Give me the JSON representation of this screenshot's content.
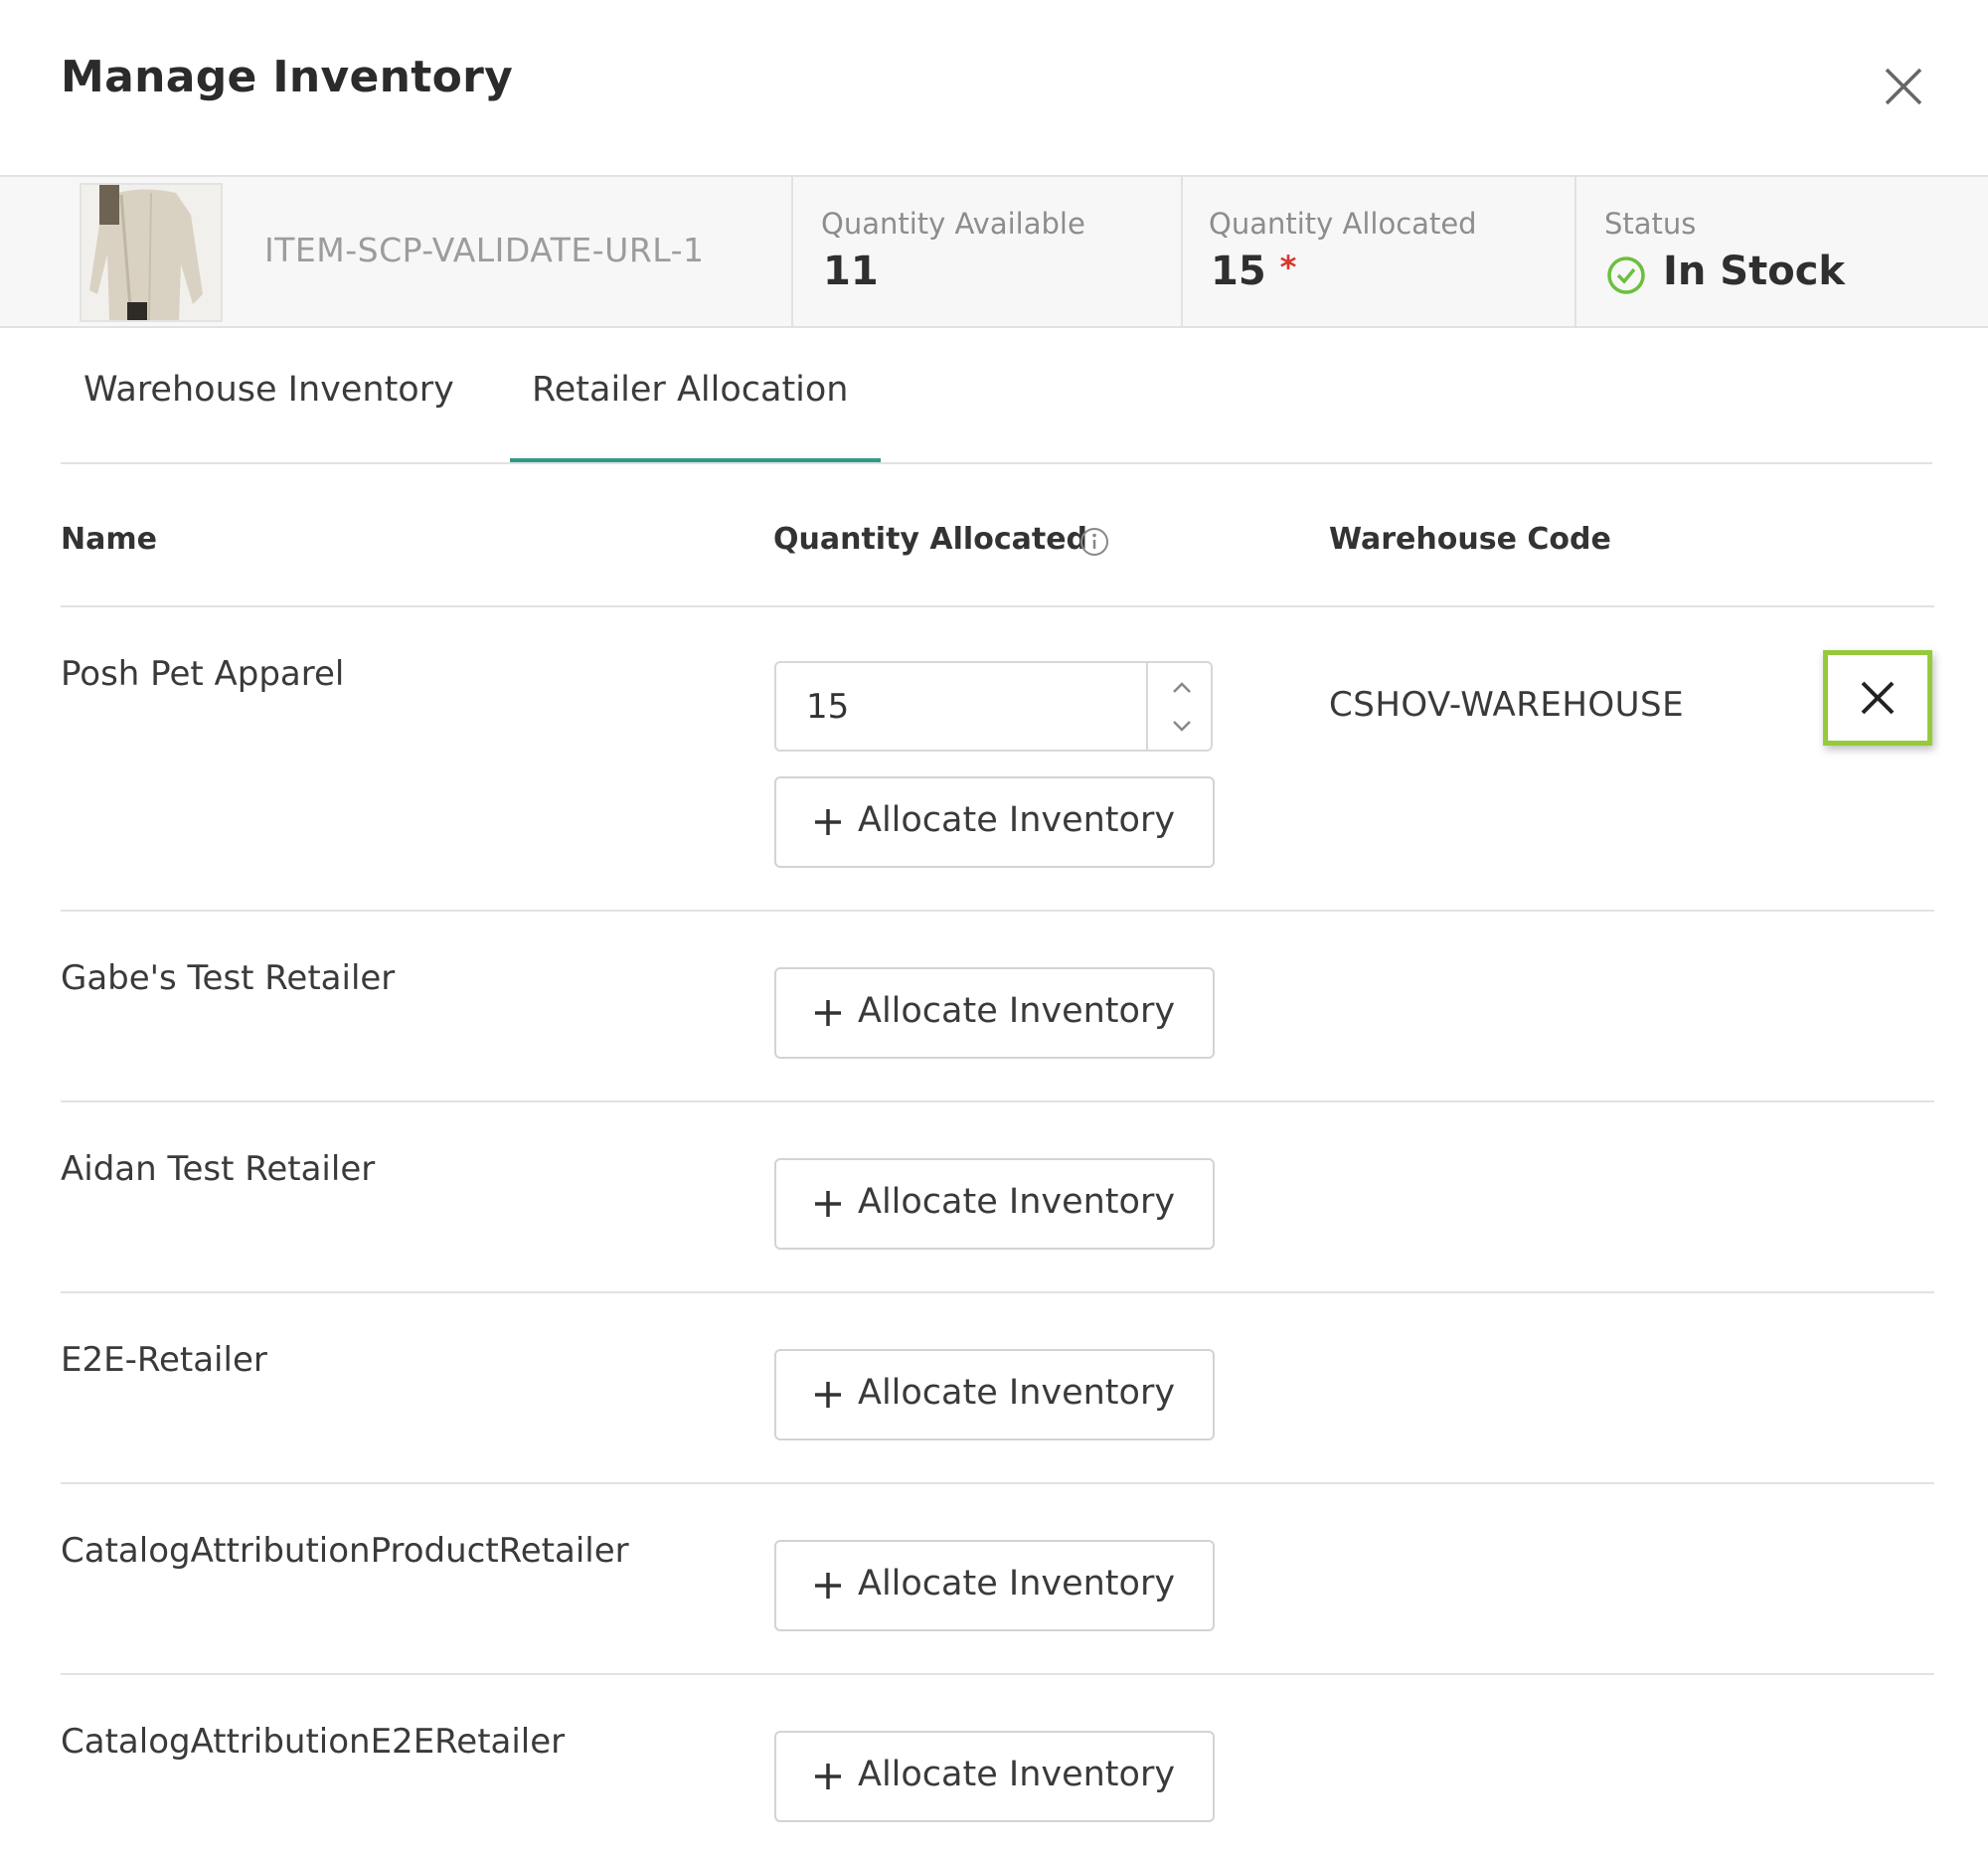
{
  "dialog": {
    "title": "Manage Inventory"
  },
  "item": {
    "sku": "ITEM-SCP-VALIDATE-URL-1",
    "quantity_available_label": "Quantity Available",
    "quantity_available": "11",
    "quantity_allocated_label": "Quantity Allocated",
    "quantity_allocated": "15",
    "required_marker": "*",
    "status_label": "Status",
    "status": "In Stock"
  },
  "tabs": [
    {
      "label": "Warehouse Inventory",
      "active": false
    },
    {
      "label": "Retailer Allocation",
      "active": true
    }
  ],
  "table": {
    "headers": {
      "name": "Name",
      "quantity_allocated": "Quantity Allocated",
      "warehouse_code": "Warehouse Code"
    },
    "rows": [
      {
        "name": "Posh Pet Apparel",
        "quantity": "15",
        "warehouse_code": "CSHOV-WAREHOUSE",
        "button": "Allocate Inventory"
      },
      {
        "name": "Gabe's Test Retailer",
        "button": "Allocate Inventory"
      },
      {
        "name": "Aidan Test Retailer",
        "button": "Allocate Inventory"
      },
      {
        "name": "E2E-Retailer",
        "button": "Allocate Inventory"
      },
      {
        "name": "CatalogAttributionProductRetailer",
        "button": "Allocate Inventory"
      },
      {
        "name": "CatalogAttributionE2ERetailer",
        "button": "Allocate Inventory"
      }
    ]
  },
  "colors": {
    "accent_teal": "#2f9a8a",
    "status_green": "#6cbf3c",
    "required_red": "#d9362f",
    "highlight_green": "#97c93c"
  }
}
